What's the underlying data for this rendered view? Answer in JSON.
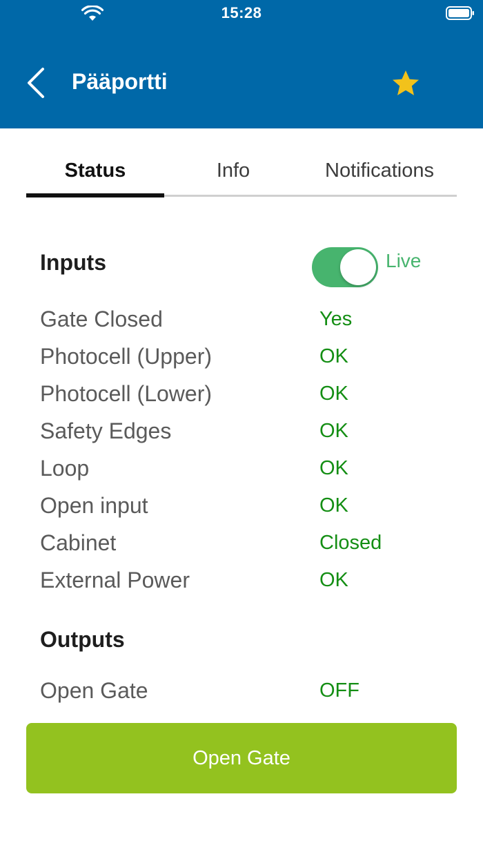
{
  "status_bar": {
    "time": "15:28",
    "wifi_icon": "wifi-icon",
    "battery_icon": "battery-icon"
  },
  "header": {
    "title": "Pääportti",
    "back_icon": "chevron-left-icon",
    "favorite_icon": "star-icon",
    "background_color": "#0068a8",
    "star_color": "#f2c21b"
  },
  "tabs": [
    {
      "label": "Status",
      "active": true
    },
    {
      "label": "Info",
      "active": false
    },
    {
      "label": "Notifications",
      "active": false
    }
  ],
  "inputs": {
    "title": "Inputs",
    "live_toggle": {
      "label": "Live",
      "on": true,
      "color": "#47b46e"
    },
    "rows": [
      {
        "label": "Gate Closed",
        "value": "Yes"
      },
      {
        "label": "Photocell (Upper)",
        "value": "OK"
      },
      {
        "label": "Photocell (Lower)",
        "value": "OK"
      },
      {
        "label": "Safety Edges",
        "value": "OK"
      },
      {
        "label": "Loop",
        "value": "OK"
      },
      {
        "label": "Open input",
        "value": "OK"
      },
      {
        "label": "Cabinet",
        "value": "Closed"
      },
      {
        "label": "External Power",
        "value": "OK"
      }
    ]
  },
  "outputs": {
    "title": "Outputs",
    "rows": [
      {
        "label": "Open Gate",
        "value": "OFF"
      }
    ]
  },
  "action_button": {
    "label": "Open Gate",
    "color": "#93c21f"
  },
  "status_value_color": "#148e14"
}
